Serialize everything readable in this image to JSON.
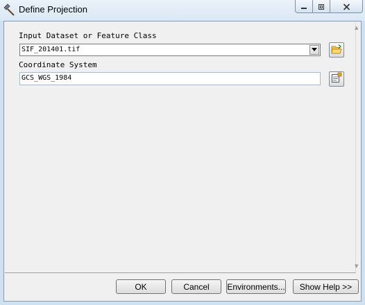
{
  "window": {
    "title": "Define Projection",
    "controls": {
      "minimize": "minimize-icon",
      "maximize": "maximize-icon",
      "close": "close-icon"
    }
  },
  "form": {
    "input_label": "Input Dataset or Feature Class",
    "input_value": "SIF_201401.tif",
    "coord_label": "Coordinate System",
    "coord_value": "GCS_WGS_1984"
  },
  "buttons": {
    "ok": "OK",
    "cancel": "Cancel",
    "environments": "Environments...",
    "show_help": "Show Help >>"
  },
  "icons": {
    "title": "hammer-icon",
    "browse": "folder-open-icon",
    "properties": "coordinate-properties-icon"
  },
  "colors": {
    "titlebar": "#dbe8f5",
    "panel": "#f0f0f0",
    "accent": "#e0a020"
  }
}
